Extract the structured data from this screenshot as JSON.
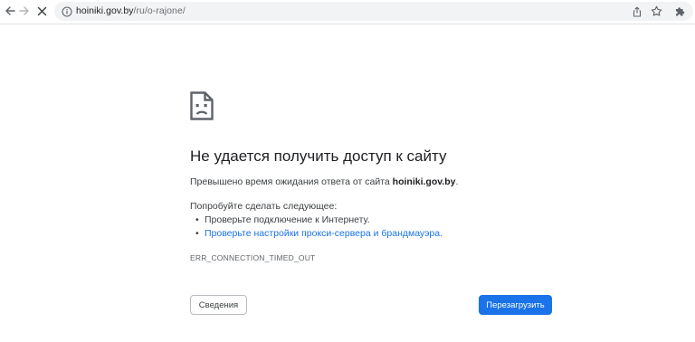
{
  "browser": {
    "address_host": "hoiniki.gov.by",
    "address_path": "/ru/o-rajone/",
    "icons": [
      "back-arrow-icon",
      "forward-arrow-icon",
      "stop-loading-icon",
      "site-info-icon",
      "share-icon",
      "bookmark-star-icon",
      "extensions-icon"
    ]
  },
  "error_page": {
    "title": "Не удается получить доступ к сайту",
    "timeout_prefix": "Превышено время ожидания ответа от сайта ",
    "timeout_host": "hoiniki.gov.by",
    "timeout_suffix": ".",
    "try_heading": "Попробуйте сделать следующее:",
    "suggestion_check_connection": "Проверьте подключение к Интернету.",
    "suggestion_check_proxy": "Проверьте настройки прокси-сервера и брандмауэра.",
    "error_code": "ERR_CONNECTION_TIMED_OUT",
    "details_button": "Сведения",
    "reload_button": "Перезагрузить",
    "icon": "sad-document-icon"
  },
  "colors": {
    "accent": "#1a73e8",
    "title_text": "#202124",
    "body_text": "#3c4043",
    "code_text": "#5f6368",
    "omnibox_bg": "#f1f3f4"
  }
}
